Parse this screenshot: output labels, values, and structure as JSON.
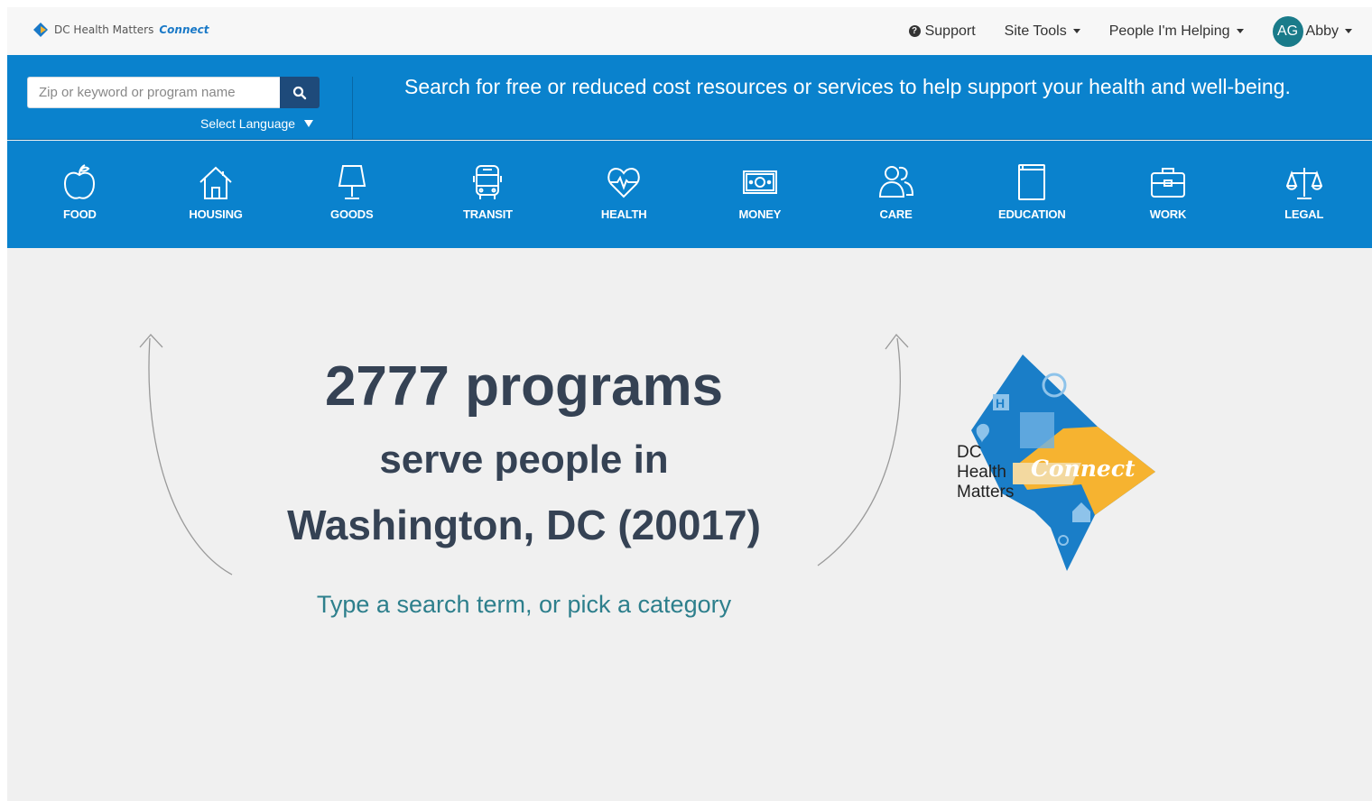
{
  "header": {
    "logo_text": "DC Health Matters",
    "logo_accent": "Connect",
    "support_label": "Support",
    "site_tools_label": "Site Tools",
    "people_label": "People I'm Helping",
    "avatar_initials": "AG",
    "user_name": "Abby"
  },
  "search": {
    "placeholder": "Zip or keyword or program name",
    "language_label": "Select Language",
    "tagline": "Search for free or reduced cost resources or services to help support your health and well-being."
  },
  "categories": [
    {
      "label": "FOOD",
      "icon": "apple-icon"
    },
    {
      "label": "HOUSING",
      "icon": "house-icon"
    },
    {
      "label": "GOODS",
      "icon": "lamp-icon"
    },
    {
      "label": "TRANSIT",
      "icon": "bus-icon"
    },
    {
      "label": "HEALTH",
      "icon": "heart-pulse-icon"
    },
    {
      "label": "MONEY",
      "icon": "banknote-icon"
    },
    {
      "label": "CARE",
      "icon": "people-icon"
    },
    {
      "label": "EDUCATION",
      "icon": "book-icon"
    },
    {
      "label": "WORK",
      "icon": "briefcase-icon"
    },
    {
      "label": "LEGAL",
      "icon": "scales-icon"
    }
  ],
  "hero": {
    "count_text": "2777 programs",
    "serve_text": "serve people in",
    "location_text": "Washington, DC (20017)",
    "subtext": "Type a search term, or pick a category"
  },
  "brand_logo": {
    "line1": "DC",
    "line2": "Health",
    "line3": "Matters",
    "accent": "Connect"
  },
  "colors": {
    "primary_blue": "#0a82cd",
    "search_button": "#1e4a7a",
    "heading": "#354254",
    "teal_text": "#2d7f8c",
    "avatar": "#1a7b8a",
    "logo_yellow": "#f6b330"
  }
}
